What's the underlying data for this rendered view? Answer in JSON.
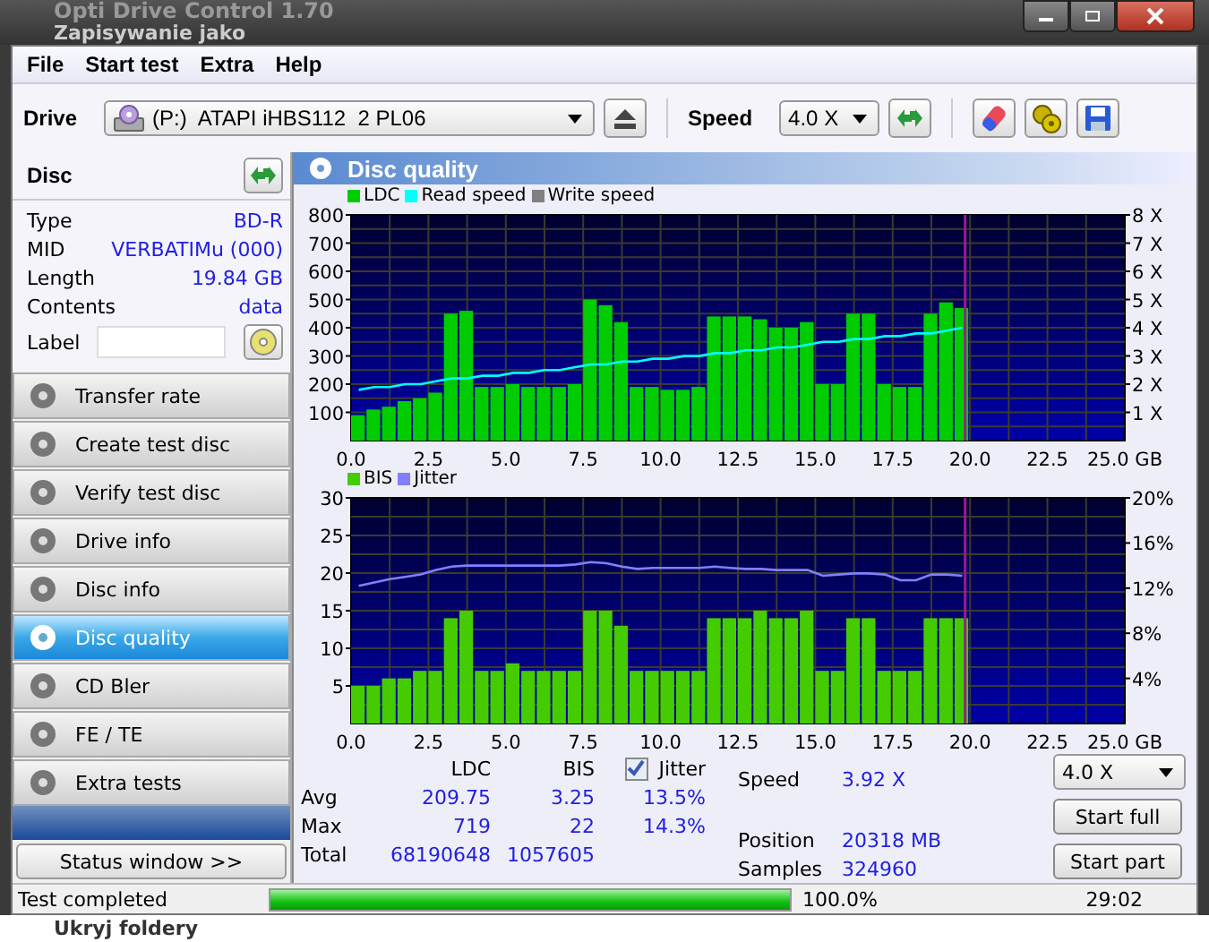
{
  "window": {
    "title": "Opti Drive Control 1.70",
    "behind_title": "Zapisywanie jako",
    "behind_bottom": "Ukryj foldery"
  },
  "menu": [
    "File",
    "Start test",
    "Extra",
    "Help"
  ],
  "toolbar": {
    "drive_label": "Drive",
    "drive": "(P:)  ATAPI iHBS112  2 PL06",
    "speed_label": "Speed",
    "speed": "4.0 X"
  },
  "disc": {
    "title": "Disc",
    "fields": [
      {
        "label": "Type",
        "value": "BD-R"
      },
      {
        "label": "MID",
        "value": "VERBATIMu (000)"
      },
      {
        "label": "Length",
        "value": "19.84 GB"
      },
      {
        "label": "Contents",
        "value": "data"
      }
    ],
    "label_field": "Label"
  },
  "sidebar": {
    "items": [
      {
        "label": "Transfer rate",
        "selected": false
      },
      {
        "label": "Create test disc",
        "selected": false
      },
      {
        "label": "Verify test disc",
        "selected": false
      },
      {
        "label": "Drive info",
        "selected": false
      },
      {
        "label": "Disc info",
        "selected": false
      },
      {
        "label": "Disc quality",
        "selected": true
      },
      {
        "label": "CD Bler",
        "selected": false
      },
      {
        "label": "FE / TE",
        "selected": false
      },
      {
        "label": "Extra tests",
        "selected": false
      }
    ],
    "status_button": "Status window >>"
  },
  "panel": {
    "title": "Disc quality",
    "charts": [
      {
        "extra_legend": [
          {
            "label": "Write speed",
            "color": "#808080"
          }
        ],
        "chart_data": {
          "type": "bar",
          "grid": true,
          "legend": "top-left",
          "xlim": [
            0,
            25
          ],
          "ylim": [
            0,
            800
          ],
          "y2lim": [
            0,
            8
          ],
          "xticks": [
            {
              "value": 0,
              "label": "0.0"
            },
            {
              "value": 2.5,
              "label": "2.5"
            },
            {
              "value": 5,
              "label": "5.0"
            },
            {
              "value": 7.5,
              "label": "7.5"
            },
            {
              "value": 10,
              "label": "10.0"
            },
            {
              "value": 12.5,
              "label": "12.5"
            },
            {
              "value": 15,
              "label": "15.0"
            },
            {
              "value": 17.5,
              "label": "17.5"
            },
            {
              "value": 20,
              "label": "20.0"
            },
            {
              "value": 22.5,
              "label": "22.5"
            },
            {
              "value": 25,
              "label": "25.0 GB"
            }
          ],
          "yticks": [
            100,
            200,
            300,
            400,
            500,
            600,
            700,
            800
          ],
          "y2ticks": [
            {
              "value": 1,
              "label": "1 X"
            },
            {
              "value": 2,
              "label": "2 X"
            },
            {
              "value": 3,
              "label": "3 X"
            },
            {
              "value": 4,
              "label": "4 X"
            },
            {
              "value": 5,
              "label": "5 X"
            },
            {
              "value": 6,
              "label": "6 X"
            },
            {
              "value": 7,
              "label": "7 X"
            },
            {
              "value": 8,
              "label": "8 X"
            }
          ],
          "ref_lines": [
            {
              "value": 19.84,
              "axis": "x",
              "color": "#a01890"
            }
          ],
          "x": [
            0.25,
            0.75,
            1.25,
            1.75,
            2.25,
            2.75,
            3.25,
            3.75,
            4.25,
            4.75,
            5.25,
            5.75,
            6.25,
            6.75,
            7.25,
            7.75,
            8.25,
            8.75,
            9.25,
            9.75,
            10.25,
            10.75,
            11.25,
            11.75,
            12.25,
            12.75,
            13.25,
            13.75,
            14.25,
            14.75,
            15.25,
            15.75,
            16.25,
            16.75,
            17.25,
            17.75,
            18.25,
            18.75,
            19.25,
            19.75
          ],
          "series": [
            {
              "name": "LDC",
              "color": "#00cc00",
              "type": "bar",
              "values": [
                90,
                110,
                120,
                140,
                150,
                170,
                450,
                460,
                190,
                190,
                200,
                190,
                190,
                190,
                200,
                500,
                480,
                420,
                190,
                190,
                180,
                180,
                190,
                440,
                440,
                440,
                430,
                400,
                400,
                420,
                200,
                200,
                450,
                450,
                200,
                190,
                190,
                450,
                490,
                470
              ]
            },
            {
              "name": "Read speed",
              "color": "#00ffff",
              "type": "line",
              "axis": "y2",
              "values": [
                1.8,
                1.9,
                1.9,
                2.0,
                2.0,
                2.1,
                2.2,
                2.2,
                2.3,
                2.3,
                2.4,
                2.4,
                2.5,
                2.5,
                2.6,
                2.7,
                2.7,
                2.8,
                2.8,
                2.9,
                2.9,
                3.0,
                3.0,
                3.1,
                3.1,
                3.2,
                3.2,
                3.3,
                3.3,
                3.4,
                3.5,
                3.5,
                3.6,
                3.6,
                3.7,
                3.7,
                3.8,
                3.8,
                3.9,
                4.0
              ]
            }
          ]
        }
      },
      {
        "chart_data": {
          "type": "bar",
          "grid": true,
          "legend": "top-left",
          "xlim": [
            0,
            25
          ],
          "ylim": [
            0,
            30
          ],
          "y2lim": [
            0,
            20
          ],
          "xticks": [
            {
              "value": 0,
              "label": "0.0"
            },
            {
              "value": 2.5,
              "label": "2.5"
            },
            {
              "value": 5,
              "label": "5.0"
            },
            {
              "value": 7.5,
              "label": "7.5"
            },
            {
              "value": 10,
              "label": "10.0"
            },
            {
              "value": 12.5,
              "label": "12.5"
            },
            {
              "value": 15,
              "label": "15.0"
            },
            {
              "value": 17.5,
              "label": "17.5"
            },
            {
              "value": 20,
              "label": "20.0"
            },
            {
              "value": 22.5,
              "label": "22.5"
            },
            {
              "value": 25,
              "label": "25.0 GB"
            }
          ],
          "yticks": [
            5,
            10,
            15,
            20,
            25,
            30
          ],
          "y2ticks": [
            {
              "value": 4,
              "label": "4%"
            },
            {
              "value": 8,
              "label": "8%"
            },
            {
              "value": 12,
              "label": "12%"
            },
            {
              "value": 16,
              "label": "16%"
            },
            {
              "value": 20,
              "label": "20%"
            }
          ],
          "ref_lines": [
            {
              "value": 19.84,
              "axis": "x",
              "color": "#a01890"
            }
          ],
          "x": [
            0.25,
            0.75,
            1.25,
            1.75,
            2.25,
            2.75,
            3.25,
            3.75,
            4.25,
            4.75,
            5.25,
            5.75,
            6.25,
            6.75,
            7.25,
            7.75,
            8.25,
            8.75,
            9.25,
            9.75,
            10.25,
            10.75,
            11.25,
            11.75,
            12.25,
            12.75,
            13.25,
            13.75,
            14.25,
            14.75,
            15.25,
            15.75,
            16.25,
            16.75,
            17.25,
            17.75,
            18.25,
            18.75,
            19.25,
            19.75
          ],
          "series": [
            {
              "name": "BIS",
              "color": "#44cc00",
              "type": "bar",
              "values": [
                5,
                5,
                6,
                6,
                7,
                7,
                14,
                15,
                7,
                7,
                8,
                7,
                7,
                7,
                7,
                15,
                15,
                13,
                7,
                7,
                7,
                7,
                7,
                14,
                14,
                14,
                15,
                14,
                14,
                15,
                7,
                7,
                14,
                14,
                7,
                7,
                7,
                14,
                14,
                14
              ]
            },
            {
              "name": "Jitter",
              "color": "#8080ff",
              "type": "line",
              "axis": "y2",
              "values": [
                12.2,
                12.5,
                12.8,
                13,
                13.2,
                13.6,
                13.9,
                14,
                14,
                14,
                14,
                14,
                14,
                14,
                14.1,
                14.3,
                14.2,
                13.9,
                13.7,
                13.8,
                13.8,
                13.8,
                13.8,
                13.9,
                13.8,
                13.7,
                13.7,
                13.6,
                13.6,
                13.6,
                13.1,
                13.2,
                13.3,
                13.3,
                13.2,
                12.7,
                12.7,
                13.2,
                13.2,
                13.1
              ]
            }
          ]
        }
      }
    ]
  },
  "stats": {
    "columns": [
      "LDC",
      "BIS"
    ],
    "jitter": {
      "label": "Jitter",
      "checked": true
    },
    "rows": [
      {
        "label": "Avg",
        "ldc": "209.75",
        "bis": "3.25",
        "jitter": "13.5%"
      },
      {
        "label": "Max",
        "ldc": "719",
        "bis": "22",
        "jitter": "14.3%"
      },
      {
        "label": "Total",
        "ldc": "68190648",
        "bis": "1057605"
      }
    ]
  },
  "readings": [
    {
      "label": "Speed",
      "value": "3.92 X"
    },
    {
      "label": "Position",
      "value": "20318 MB"
    },
    {
      "label": "Samples",
      "value": "324960"
    }
  ],
  "controls": {
    "speed": "4.0 X",
    "buttons": [
      "Start full",
      "Start part"
    ]
  },
  "status_bar": {
    "message": "Test completed",
    "level": 1.0,
    "percent": "100.0%",
    "time": "29:02"
  }
}
